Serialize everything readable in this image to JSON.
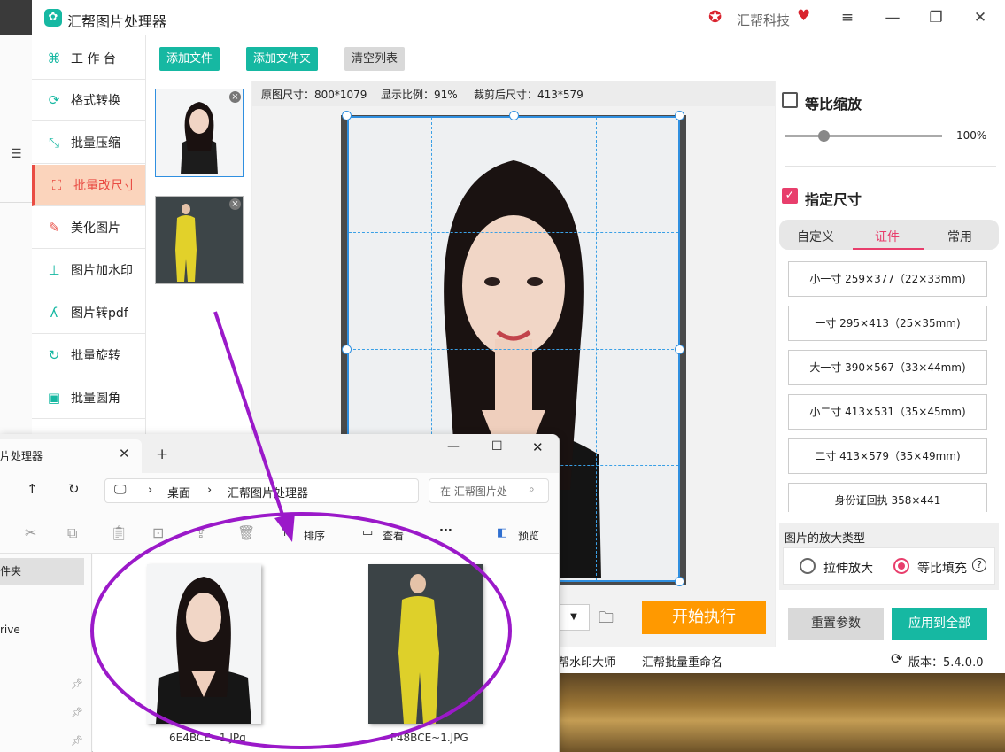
{
  "app": {
    "title": "汇帮图片处理器",
    "brand": "汇帮科技",
    "window_controls": [
      "≡",
      "—",
      "❐",
      "✕"
    ]
  },
  "nav": {
    "items": [
      {
        "label": "工 作 台",
        "icon": "grid-icon"
      },
      {
        "label": "格式转换",
        "icon": "convert-icon"
      },
      {
        "label": "批量压缩",
        "icon": "compress-icon"
      },
      {
        "label": "批量改尺寸",
        "icon": "resize-icon"
      },
      {
        "label": "美化图片",
        "icon": "beautify-icon"
      },
      {
        "label": "图片加水印",
        "icon": "watermark-icon"
      },
      {
        "label": "图片转pdf",
        "icon": "pdf-icon"
      },
      {
        "label": "批量旋转",
        "icon": "rotate-icon"
      },
      {
        "label": "批量圆角",
        "icon": "round-corner-icon"
      }
    ],
    "active_index": 3
  },
  "toolbar": {
    "add_file": "添加文件",
    "add_folder": "添加文件夹",
    "clear_list": "清空列表"
  },
  "info": {
    "original_size": "原图尺寸：800*1079",
    "display_ratio": "显示比例：91%",
    "cropped_size": "裁剪后尺寸：413*579"
  },
  "right_panel": {
    "proportional_label": "等比缩放",
    "proportional_checked": false,
    "zoom_value": "100%",
    "zoom_fraction": 0.2,
    "specify_size_label": "指定尺寸",
    "specify_size_checked": true,
    "tabs": [
      "自定义",
      "证件",
      "常用"
    ],
    "active_tab": 1,
    "sizes": [
      "小一寸 259×377（22×33mm)",
      "一寸 295×413（25×35mm)",
      "大一寸 390×567（33×44mm)",
      "小二寸 413×531（35×45mm)",
      "二寸 413×579（35×49mm)",
      "身份证回执 358×441"
    ],
    "enlarge_title": "图片的放大类型",
    "enlarge_options": [
      "拉伸放大",
      "等比填充"
    ],
    "enlarge_selected": 1,
    "help": "?",
    "reset": "重置参数",
    "apply_all": "应用到全部"
  },
  "actions": {
    "start": "开始执行"
  },
  "footer": {
    "link1": "帮水印大师",
    "link2": "汇帮批量重命名",
    "version": "版本：5.4.0.0"
  },
  "explorer": {
    "tab_title": "片处理器",
    "breadcrumb_1": "桌面",
    "breadcrumb_2": "汇帮图片处理器",
    "search_placeholder": "在 汇帮图片处",
    "sort": "排序",
    "view": "查看",
    "more": "···",
    "preview": "预览",
    "nav_items": [
      "件夹",
      "rive"
    ],
    "files": [
      {
        "name": "6E4BCE~1.JPg"
      },
      {
        "name": "F48BCE~1.JPG"
      }
    ]
  },
  "colors": {
    "accent": "#16b8a2",
    "active_nav": "#e94c43",
    "pink": "#e83e6c",
    "orange": "#ff9900",
    "annotation": "#9b19c9"
  }
}
